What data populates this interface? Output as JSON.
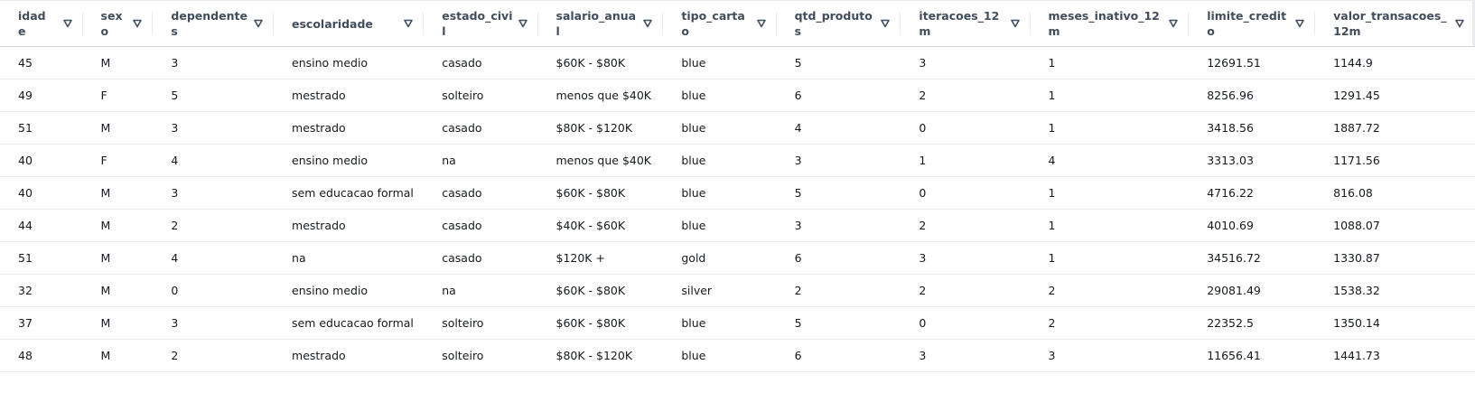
{
  "columns": [
    {
      "label": "idade",
      "display": "idad\ne"
    },
    {
      "label": "sexo",
      "display": "sex\no"
    },
    {
      "label": "dependentes",
      "display": "dependentes"
    },
    {
      "label": "escolaridade",
      "display": "escolaridade"
    },
    {
      "label": "estado_civil",
      "display": "estado_civil"
    },
    {
      "label": "salario_anual",
      "display": "salario_anual"
    },
    {
      "label": "tipo_cartao",
      "display": "tipo_cartao"
    },
    {
      "label": "qtd_produtos",
      "display": "qtd_produto\ns"
    },
    {
      "label": "iteracoes_12m",
      "display": "iteracoes_12\nm"
    },
    {
      "label": "meses_inativo_12m",
      "display": "meses_inativo_12\nm"
    },
    {
      "label": "limite_credito",
      "display": "limite_credit\no"
    },
    {
      "label": "valor_transacoes_12m",
      "display": "valor_transacoes_12m"
    }
  ],
  "rows": [
    [
      "45",
      "M",
      "3",
      "ensino medio",
      "casado",
      "$60K - $80K",
      "blue",
      "5",
      "3",
      "1",
      "12691.51",
      "1144.9"
    ],
    [
      "49",
      "F",
      "5",
      "mestrado",
      "solteiro",
      "menos que $40K",
      "blue",
      "6",
      "2",
      "1",
      "8256.96",
      "1291.45"
    ],
    [
      "51",
      "M",
      "3",
      "mestrado",
      "casado",
      "$80K - $120K",
      "blue",
      "4",
      "0",
      "1",
      "3418.56",
      "1887.72"
    ],
    [
      "40",
      "F",
      "4",
      "ensino medio",
      "na",
      "menos que $40K",
      "blue",
      "3",
      "1",
      "4",
      "3313.03",
      "1171.56"
    ],
    [
      "40",
      "M",
      "3",
      "sem educacao formal",
      "casado",
      "$60K - $80K",
      "blue",
      "5",
      "0",
      "1",
      "4716.22",
      "816.08"
    ],
    [
      "44",
      "M",
      "2",
      "mestrado",
      "casado",
      "$40K - $60K",
      "blue",
      "3",
      "2",
      "1",
      "4010.69",
      "1088.07"
    ],
    [
      "51",
      "M",
      "4",
      "na",
      "casado",
      "$120K +",
      "gold",
      "6",
      "3",
      "1",
      "34516.72",
      "1330.87"
    ],
    [
      "32",
      "M",
      "0",
      "ensino medio",
      "na",
      "$60K - $80K",
      "silver",
      "2",
      "2",
      "2",
      "29081.49",
      "1538.32"
    ],
    [
      "37",
      "M",
      "3",
      "sem educacao formal",
      "solteiro",
      "$60K - $80K",
      "blue",
      "5",
      "0",
      "2",
      "22352.5",
      "1350.14"
    ],
    [
      "48",
      "M",
      "2",
      "mestrado",
      "solteiro",
      "$80K - $120K",
      "blue",
      "6",
      "3",
      "3",
      "11656.41",
      "1441.73"
    ]
  ],
  "icons": {
    "sort": "sort-filter-icon"
  },
  "colors": {
    "header_text": "#414d5c",
    "cell_text": "#16191f",
    "divider": "#e9ebed"
  }
}
